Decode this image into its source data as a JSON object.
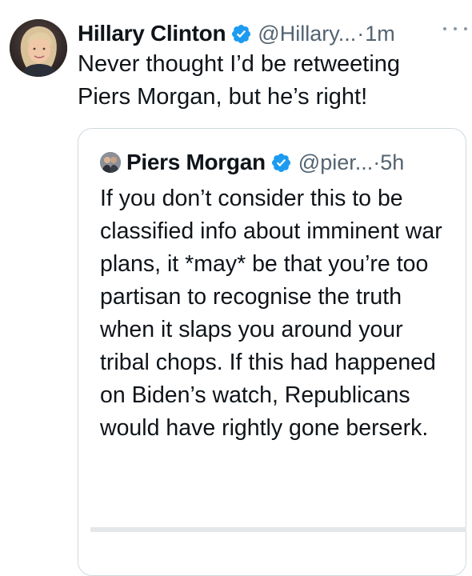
{
  "tweet": {
    "author_name": "Hillary Clinton",
    "handle": "@Hillary...",
    "separator": "·",
    "time": "1m",
    "text": "Never thought I’d be retweeting Piers Morgan, but he’s right!",
    "verified_icon": "verified-badge-icon",
    "more_icon": "more-options-icon"
  },
  "quoted_tweet": {
    "author_name": "Piers Morgan",
    "handle": "@pier...",
    "separator": "·",
    "time": "5h",
    "text": "If you don’t consider this to be classified info about imminent war plans, it *may* be that you’re too partisan to recognise the truth when it slaps you around your tribal chops. If this had happened on Biden’s watch, Republicans would have rightly gone berserk.",
    "verified_icon": "verified-badge-icon"
  },
  "colors": {
    "text_primary": "#0f1419",
    "text_secondary": "#536471",
    "verified_blue": "#1d9bf0",
    "border": "#cfd9de"
  }
}
